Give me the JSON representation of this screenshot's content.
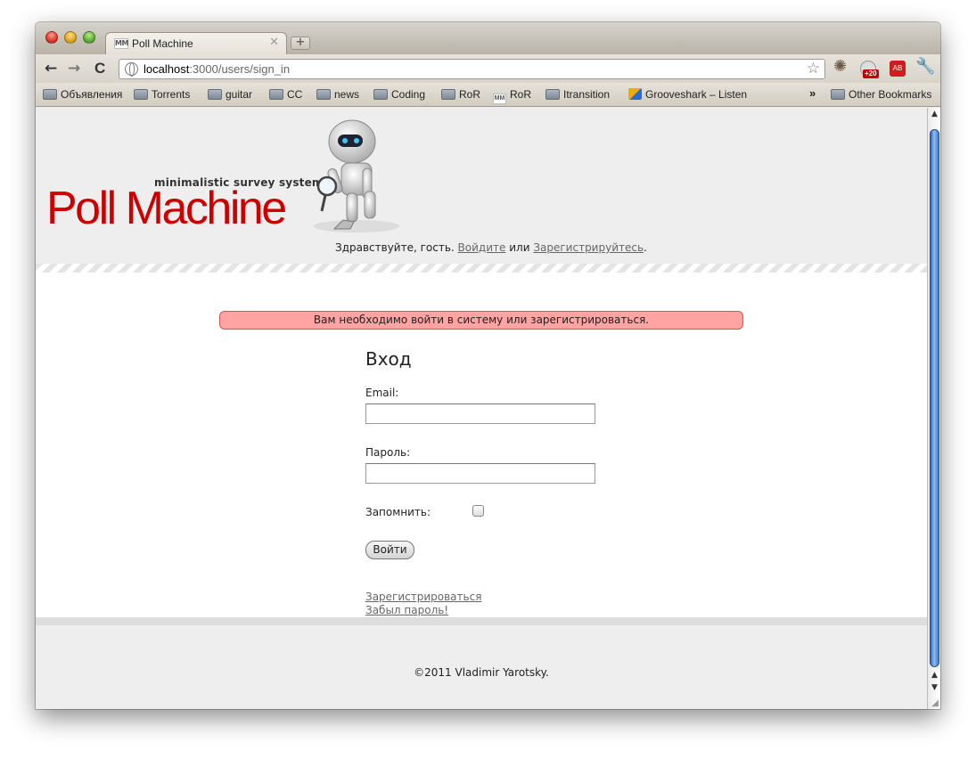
{
  "browser": {
    "tab": {
      "favicon": "MM",
      "title": "Poll Machine",
      "close": "✕"
    },
    "new_tab": "+",
    "nav": {
      "back": "←",
      "forward": "→",
      "reload": "C"
    },
    "url": {
      "host": "localhost",
      "path": ":3000/users/sign_in"
    },
    "extensions": {
      "badge_count": "+20",
      "adblock": "AB"
    },
    "bookmarks": [
      {
        "label": "Объявления",
        "icon": "folder-icon"
      },
      {
        "label": "Torrents",
        "icon": "folder-icon"
      },
      {
        "label": "guitar",
        "icon": "folder-icon"
      },
      {
        "label": "CC",
        "icon": "folder-icon"
      },
      {
        "label": "news",
        "icon": "folder-icon"
      },
      {
        "label": "Coding",
        "icon": "folder-icon"
      },
      {
        "label": "RoR",
        "icon": "folder-icon"
      },
      {
        "label": "RoR",
        "icon": "mm-favicon"
      },
      {
        "label": "Itransition",
        "icon": "folder-icon"
      },
      {
        "label": "Grooveshark – Listen",
        "icon": "grooveshark-icon"
      }
    ],
    "bookmarks_overflow": "»",
    "other_bookmarks": "Other Bookmarks"
  },
  "header": {
    "tagline": "minimalistic survey system",
    "logo": "Poll Machine",
    "greeting_prefix": "Здравствуйте, гость.",
    "login_link": "Войдите",
    "or": "или",
    "register_link": "Зарегистрируйтесь",
    "greeting_suffix": "."
  },
  "flash": "Вам необходимо войти в систему или зарегистрироваться.",
  "form": {
    "title": "Вход",
    "email_label": "Email:",
    "email_value": "",
    "password_label": "Пароль:",
    "password_value": "",
    "remember_label": "Запомнить:",
    "remember_checked": false,
    "submit": "Войти"
  },
  "links": {
    "register": "Зарегистрироваться",
    "forgot": "Забыл пароль!"
  },
  "footer": {
    "copyright": "©2011 Vladimir Yarotsky."
  },
  "colors": {
    "logo": "#cc0000",
    "flash_bg": "#ffa3a3",
    "flash_border": "#d15454",
    "header_bg": "#eeeeee"
  }
}
